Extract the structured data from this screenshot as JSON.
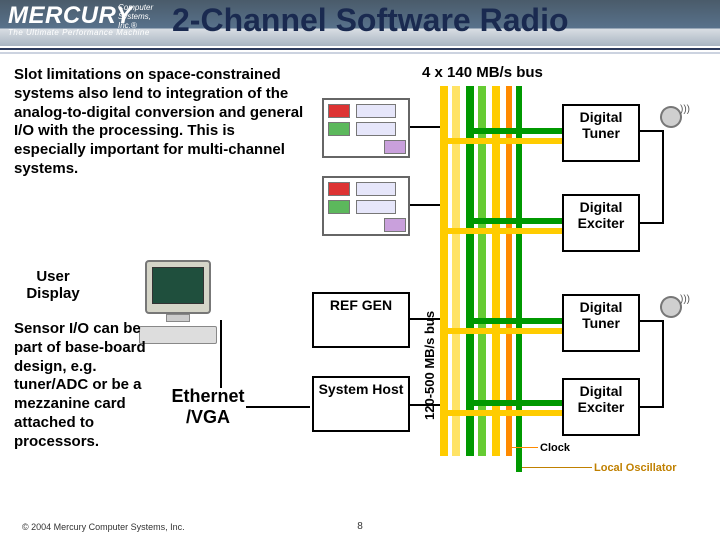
{
  "brand": {
    "name": "MERCURY",
    "super": "Computer Systems, Inc.®",
    "tagline": "The Ultimate Performance Machine"
  },
  "title": "2-Channel Software Radio",
  "paragraphs": {
    "p1": "Slot limitations on space-constrained systems also lend to integration of the analog-to-digital conversion and general I/O with the processing. This is especially important for multi-channel systems.",
    "p2": "Sensor I/O can be part of base-board design, e.g. tuner/ADC or be a mezzanine card attached to processors."
  },
  "labels": {
    "user_display": "User Display",
    "ethernet_vga": "Ethernet /VGA",
    "bus_top": "4 x 140 MB/s bus",
    "bus_vert": "120-500 MB/s bus",
    "ref_gen": "REF GEN",
    "system_host": "System Host",
    "digital_tuner": "Digital Tuner",
    "digital_exciter": "Digital Exciter",
    "clock": "Clock",
    "lo": "Local Oscillator"
  },
  "footer": "© 2004 Mercury Computer Systems, Inc.",
  "page": "8",
  "icons": {
    "monitor": "crt-monitor",
    "antenna": "dish-antenna"
  },
  "colors": {
    "bus_yellow": "#ffcc00",
    "bus_green": "#009900",
    "bus_orange": "#ff8a00",
    "title": "#1a2a50"
  }
}
